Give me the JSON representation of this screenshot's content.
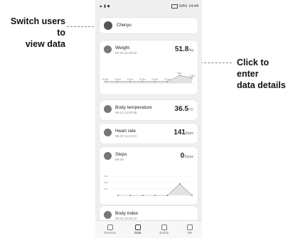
{
  "annotations": {
    "left_line1": "Switch users to",
    "left_line2": "view data",
    "right_line1": "Click to enter",
    "right_line2": "data details"
  },
  "status": {
    "time": "14:44",
    "battery": "64%"
  },
  "user": {
    "name": "Chenyu"
  },
  "weight": {
    "title": "Weight",
    "time": "05-18 16:49:10",
    "value": "51.8",
    "unit": "/kg",
    "chart_labels": [
      "50.9kg",
      "50.9kg",
      "50.9kg",
      "50.9kg",
      "50.9kg",
      "50.9kg",
      "50kg",
      "51.8kg"
    ],
    "chart_values": [
      50.9,
      50.9,
      50.9,
      50.9,
      50.9,
      50.9,
      52.4,
      51.8
    ]
  },
  "temperature": {
    "title": "Body temperature",
    "time": "06-10 12:00:48",
    "value": "36.5",
    "unit": "/°C"
  },
  "heart_rate": {
    "title": "Heart rate",
    "time": "06-20 11:10:43",
    "value": "141",
    "unit": "/bpm"
  },
  "steps": {
    "title": "Steps",
    "time": "08-20",
    "value": "0",
    "unit": "Steps",
    "y_ticks": [
      "3000",
      "2000",
      "1000"
    ],
    "chart_values": [
      0,
      0,
      0,
      0,
      0,
      1800,
      0
    ]
  },
  "body_index": {
    "title": "Body index",
    "time": "05-18 16:49:10"
  },
  "tabs": [
    "Devices",
    "Data",
    "Buddy",
    "Me"
  ]
}
